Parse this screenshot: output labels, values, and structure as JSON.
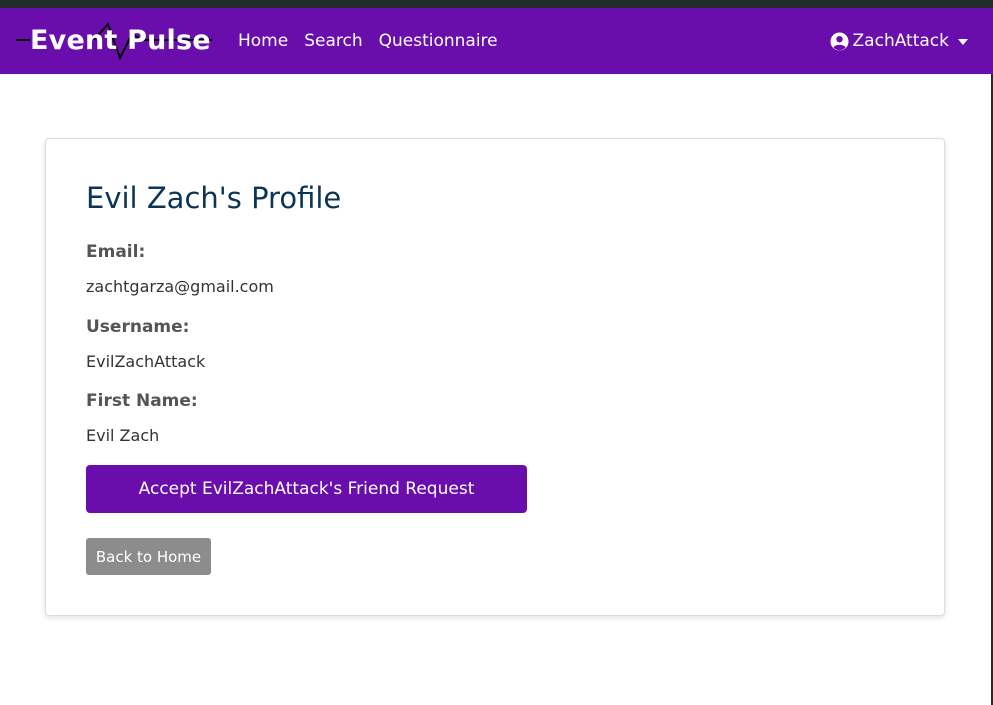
{
  "navbar": {
    "brand": "Event Pulse",
    "links": [
      {
        "label": "Home"
      },
      {
        "label": "Search"
      },
      {
        "label": "Questionnaire"
      }
    ],
    "user": {
      "username": "ZachAttack",
      "icon": "user-circle-icon"
    }
  },
  "profile": {
    "title": "Evil Zach's Profile",
    "fields": [
      {
        "label": "Email:",
        "value": "zachtgarza@gmail.com"
      },
      {
        "label": "Username:",
        "value": "EvilZachAttack"
      },
      {
        "label": "First Name:",
        "value": "Evil Zach"
      }
    ],
    "accept_button": "Accept EvilZachAttack's Friend Request",
    "back_button": "Back to Home"
  },
  "colors": {
    "brand_purple": "#6a0dad",
    "title_navy": "#0c3457",
    "back_button_gray": "#8c8c8c"
  }
}
